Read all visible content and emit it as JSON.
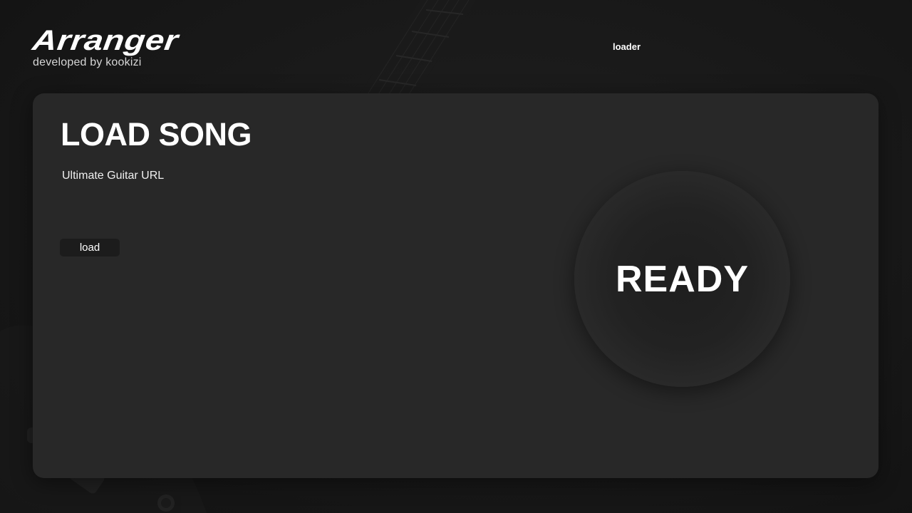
{
  "brand": {
    "title": "Arranger",
    "subtitle": "developed by kookizi"
  },
  "nav": {
    "loader_link": "loader"
  },
  "panel": {
    "title": "LOAD SONG",
    "url_label": "Ultimate Guitar URL",
    "url_value": "",
    "url_placeholder": "",
    "load_button": "load",
    "status": "READY"
  },
  "colors": {
    "background": "#161616",
    "panel": "#282828",
    "button": "#1c1c1c",
    "text": "#ffffff",
    "subtext": "#d6d6d6"
  }
}
